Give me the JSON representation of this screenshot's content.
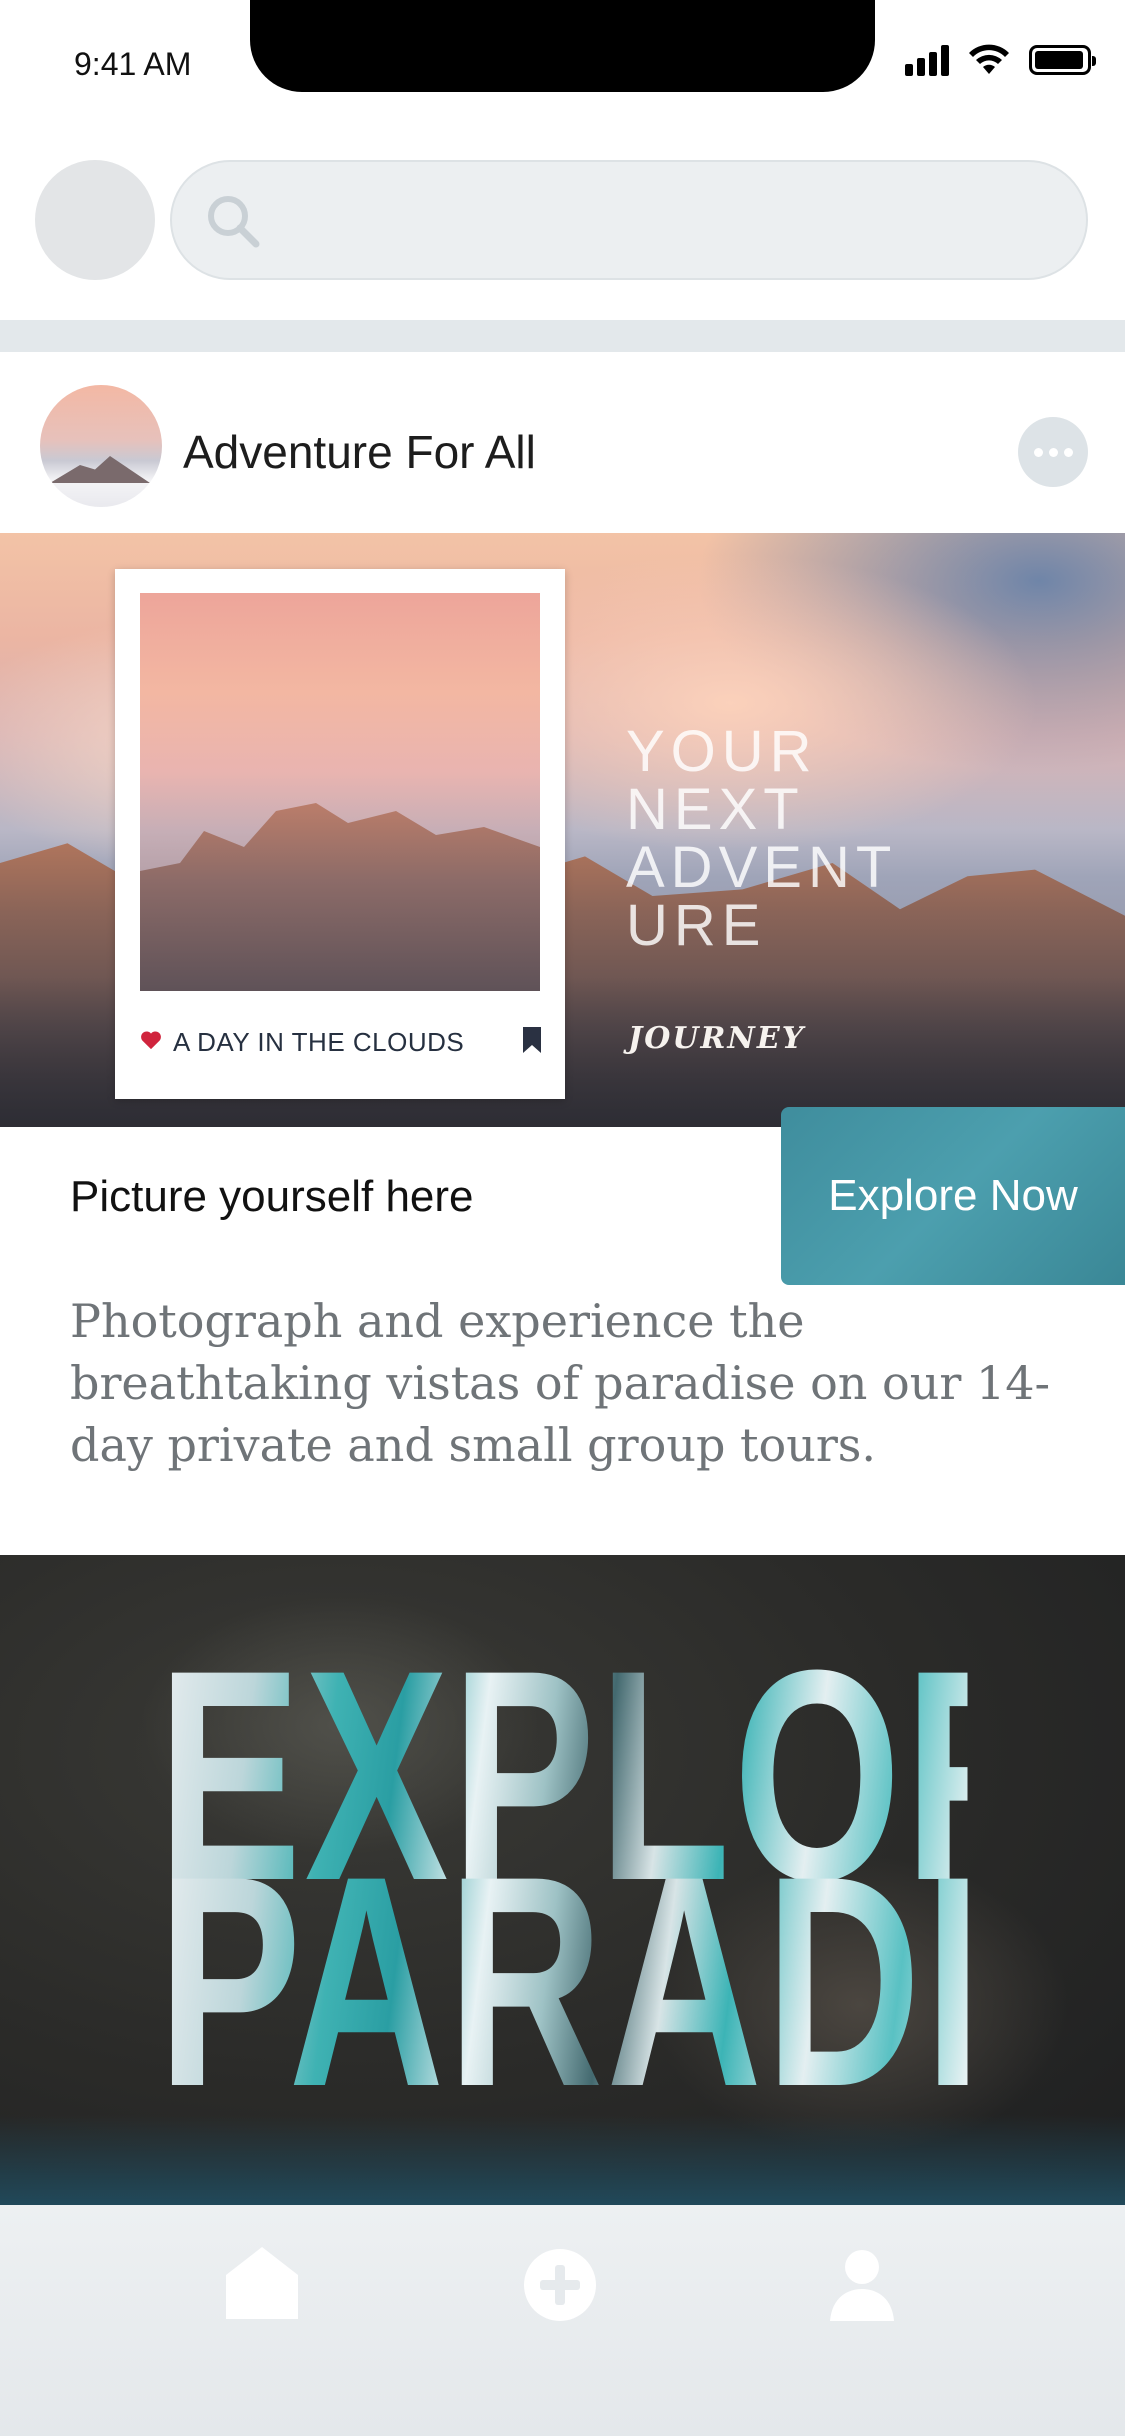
{
  "status_bar": {
    "time": "9:41 AM"
  },
  "search": {
    "placeholder": "",
    "icon": "search-icon"
  },
  "post": {
    "author": "Adventure For All",
    "hero": {
      "overlay_text": "YOUR\nNEXT\nADVENT\nURE",
      "script_text": "JOURNEY",
      "card_caption": "A DAY IN THE CLOUDS"
    },
    "cta_label": "Explore Now",
    "headline": "Picture yourself here",
    "body": "Photograph and experience the breathtaking vistas of paradise on our 14-day private and small group tours."
  },
  "paradise_image": {
    "line1": "EXPLORE",
    "line2": "PARADISE"
  },
  "tab_bar": {
    "items": [
      "home-icon",
      "add-icon",
      "profile-icon"
    ]
  },
  "colors": {
    "accent": "#4a9aa9",
    "heart": "#d0243d",
    "tab_bar": "#e8ecef",
    "search_bg": "#eceff1"
  }
}
